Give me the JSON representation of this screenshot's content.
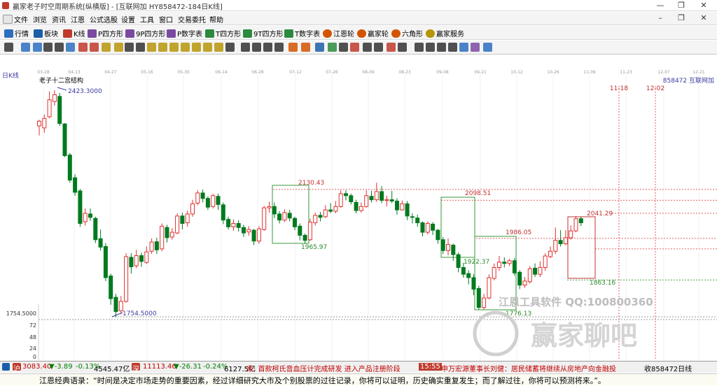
{
  "titlebar": {
    "title": "赢家老子时空周期系统[纵横版] - [互联网加  HY858472-184日K线]"
  },
  "menu": [
    "文件",
    "浏览",
    "资讯",
    "江恩",
    "公式选股",
    "设置",
    "工具",
    "窗口",
    "交易委托",
    "帮助"
  ],
  "nav": [
    {
      "label": "行情",
      "icon": "quote-icon",
      "color": "#2c6fbf"
    },
    {
      "label": "板块",
      "icon": "sector-icon",
      "color": "#1b5ea8"
    },
    {
      "label": "K线",
      "icon": "kline-icon",
      "color": "#c0392b"
    },
    {
      "label": "P四方形",
      "icon": "p-square-icon",
      "color": "#7a4aa0"
    },
    {
      "label": "9P四方形",
      "icon": "9p-square-icon",
      "color": "#7a4aa0"
    },
    {
      "label": "P数字表",
      "icon": "p-table-icon",
      "color": "#7a4aa0"
    },
    {
      "label": "T四方形",
      "icon": "t-square-icon",
      "color": "#2b8a3e"
    },
    {
      "label": "9T四方形",
      "icon": "9t-square-icon",
      "color": "#2b8a3e"
    },
    {
      "label": "T数字表",
      "icon": "t-table-icon",
      "color": "#2b8a3e"
    },
    {
      "label": "江恩轮",
      "icon": "gann-wheel-icon",
      "color": "#d35400"
    },
    {
      "label": "赢家轮",
      "icon": "winner-wheel-icon",
      "color": "#d35400"
    },
    {
      "label": "六角形",
      "icon": "hexagon-icon",
      "color": "#d35400"
    },
    {
      "label": "赢家服务",
      "icon": "service-icon",
      "color": "#b7950b"
    }
  ],
  "toolbar_colors": [
    "#333333",
    "#2c6fbf",
    "#2c6fbf",
    "#333333",
    "#333333",
    "#2c6fbf",
    "#c0392b",
    "#c0392b",
    "#b7950b",
    "#b7950b",
    "#333333",
    "#333333",
    "#b7950b",
    "#b7950b",
    "#b7950b",
    "#b7950b",
    "#b7950b",
    "#b7950b",
    "#b7950b",
    "#333333",
    "#333333",
    "#333333",
    "#333333",
    "#333333",
    "#d35400",
    "#d35400",
    "#1b5ea8",
    "#2b8a3e",
    "#333333",
    "#c0392b",
    "#333333",
    "#333333",
    "#c0392b",
    "#333333",
    "#333333",
    "#333333",
    "#333333",
    "#333333",
    "#2c6fbf",
    "#7a4aa0",
    "#2c6fbf"
  ],
  "chart_data": {
    "type": "candlestick",
    "period_label": "日K线",
    "indicator_label": "老子十二宫结构",
    "code_label": "858472  互联网加",
    "x_dates": [
      "03-28",
      "04-13",
      "04-27",
      "05-16",
      "05-30",
      "06-14",
      "06-28",
      "07-12",
      "07-26",
      "08-09",
      "08-23",
      "09-08",
      "09-21",
      "10-12",
      "10-26",
      "11-09",
      "11-23",
      "12-07",
      "12-21"
    ],
    "y_axis_labels": [
      "1754.5000",
      "72",
      "48",
      "24",
      "0"
    ],
    "up_color": "#e03030",
    "down_color": "#007a1f",
    "candles": [
      [
        2318,
        2332,
        2290,
        2336
      ],
      [
        2312,
        2340,
        2298,
        2352
      ],
      [
        2345,
        2395,
        2340,
        2420
      ],
      [
        2390,
        2410,
        2378,
        2423
      ],
      [
        2405,
        2325,
        2318,
        2415
      ],
      [
        2324,
        2230,
        2226,
        2326
      ],
      [
        2232,
        2158,
        2150,
        2238
      ],
      [
        2165,
        2122,
        2112,
        2175
      ],
      [
        2126,
        2030,
        2020,
        2132
      ],
      [
        2035,
        2060,
        2024,
        2074
      ],
      [
        2058,
        2048,
        2038,
        2074
      ],
      [
        2045,
        1982,
        1972,
        2050
      ],
      [
        1985,
        1960,
        1950,
        2012
      ],
      [
        1962,
        1870,
        1860,
        1972
      ],
      [
        1875,
        1808,
        1790,
        1882
      ],
      [
        1812,
        1770,
        1754,
        1822
      ],
      [
        1772,
        1800,
        1762,
        1816
      ],
      [
        1800,
        1932,
        1796,
        1942
      ],
      [
        1930,
        1902,
        1882,
        1942
      ],
      [
        1905,
        1935,
        1898,
        1952
      ],
      [
        1935,
        1918,
        1902,
        1944
      ],
      [
        1915,
        1946,
        1910,
        1962
      ],
      [
        1948,
        1975,
        1940,
        1986
      ],
      [
        1976,
        1952,
        1940,
        1988
      ],
      [
        1955,
        2022,
        1948,
        2030
      ],
      [
        2018,
        1988,
        1974,
        2026
      ],
      [
        1990,
        2004,
        1982,
        2016
      ],
      [
        2002,
        2052,
        1998,
        2060
      ],
      [
        2052,
        2030,
        2012,
        2062
      ],
      [
        2032,
        2058,
        2020,
        2068
      ],
      [
        2058,
        2088,
        2050,
        2100
      ],
      [
        2090,
        2120,
        2084,
        2128
      ],
      [
        2120,
        2104,
        2092,
        2130
      ],
      [
        2104,
        2078,
        2070,
        2110
      ],
      [
        2080,
        2112,
        2074,
        2118
      ],
      [
        2110,
        2086,
        2070,
        2118
      ],
      [
        2085,
        2040,
        2028,
        2092
      ],
      [
        2042,
        2020,
        2012,
        2050
      ],
      [
        2020,
        2030,
        2008,
        2042
      ],
      [
        2030,
        2018,
        2006,
        2040
      ],
      [
        2018,
        2002,
        1990,
        2026
      ],
      [
        2005,
        2012,
        1994,
        2022
      ],
      [
        2010,
        1978,
        1966,
        2014
      ],
      [
        1978,
        2014,
        1970,
        2022
      ],
      [
        2012,
        2076,
        2008,
        2082
      ],
      [
        2076,
        2080,
        2062,
        2094
      ],
      [
        2080,
        2058,
        2046,
        2092
      ],
      [
        2058,
        2040,
        2030,
        2066
      ],
      [
        2040,
        2062,
        2034,
        2072
      ],
      [
        2060,
        2046,
        2036,
        2070
      ],
      [
        2045,
        2020,
        2010,
        2050
      ],
      [
        2022,
        1995,
        1980,
        2030
      ],
      [
        1995,
        1980,
        1970,
        2000
      ],
      [
        1982,
        2034,
        1978,
        2044
      ],
      [
        2032,
        2054,
        2024,
        2062
      ],
      [
        2054,
        2048,
        2036,
        2064
      ],
      [
        2050,
        2070,
        2046,
        2084
      ],
      [
        2070,
        2066,
        2060,
        2090
      ],
      [
        2066,
        2080,
        2060,
        2096
      ],
      [
        2080,
        2118,
        2076,
        2128
      ],
      [
        2118,
        2112,
        2098,
        2128
      ],
      [
        2112,
        2094,
        2086,
        2118
      ],
      [
        2092,
        2068,
        2060,
        2100
      ],
      [
        2068,
        2080,
        2062,
        2092
      ],
      [
        2080,
        2112,
        2076,
        2128
      ],
      [
        2110,
        2100,
        2092,
        2126
      ],
      [
        2100,
        2124,
        2094,
        2150
      ],
      [
        2124,
        2098,
        2090,
        2140
      ],
      [
        2098,
        2100,
        2080,
        2112
      ],
      [
        2100,
        2096,
        2090,
        2126
      ],
      [
        2096,
        2070,
        2056,
        2104
      ],
      [
        2070,
        2088,
        2068,
        2098
      ],
      [
        2088,
        2052,
        2040,
        2096
      ],
      [
        2050,
        2048,
        2030,
        2060
      ],
      [
        2046,
        2032,
        2020,
        2056
      ],
      [
        2032,
        2004,
        1992,
        2036
      ],
      [
        2004,
        2030,
        1998,
        2036
      ],
      [
        2028,
        2010,
        1996,
        2034
      ],
      [
        2010,
        1982,
        1970,
        2014
      ],
      [
        1982,
        1950,
        1940,
        1990
      ],
      [
        1950,
        1968,
        1936,
        1986
      ],
      [
        1966,
        1938,
        1920,
        1970
      ],
      [
        1938,
        1900,
        1886,
        1944
      ],
      [
        1900,
        1880,
        1870,
        1914
      ],
      [
        1882,
        1870,
        1850,
        1892
      ],
      [
        1870,
        1836,
        1818,
        1880
      ],
      [
        1838,
        1782,
        1776,
        1846
      ],
      [
        1782,
        1810,
        1776,
        1822
      ],
      [
        1810,
        1870,
        1806,
        1880
      ],
      [
        1868,
        1900,
        1862,
        1912
      ],
      [
        1900,
        1916,
        1890,
        1934
      ],
      [
        1916,
        1912,
        1900,
        1930
      ],
      [
        1912,
        1920,
        1904,
        1926
      ],
      [
        1920,
        1884,
        1876,
        1928
      ],
      [
        1886,
        1848,
        1836,
        1892
      ],
      [
        1848,
        1860,
        1840,
        1872
      ],
      [
        1858,
        1896,
        1852,
        1904
      ],
      [
        1898,
        1880,
        1872,
        1912
      ],
      [
        1880,
        1900,
        1872,
        1918
      ],
      [
        1900,
        1934,
        1890,
        1942
      ],
      [
        1932,
        1948,
        1928,
        1962
      ],
      [
        1948,
        1980,
        1940,
        2018
      ],
      [
        1980,
        1970,
        1962,
        2010
      ],
      [
        1970,
        1988,
        1966,
        2010
      ],
      [
        1988,
        2008,
        1982,
        2024
      ],
      [
        2008,
        2044,
        2004,
        2052
      ],
      [
        2044,
        2032,
        2022,
        2050
      ]
    ],
    "annotations": [
      {
        "label": "2423.3000",
        "price": 2423.3,
        "color": "#3a3aa0"
      },
      {
        "label": "1754.5000",
        "price": 1754.5,
        "color": "#3a3aa0"
      },
      {
        "label": "2130.43",
        "price": 2130.43,
        "color": "#c03030"
      },
      {
        "label": "1965.97",
        "price": 1965.97,
        "color": "#2a8a2a"
      },
      {
        "label": "2098.51",
        "price": 2098.51,
        "color": "#c03030"
      },
      {
        "label": "1922.37",
        "price": 1922.37,
        "color": "#2a8a2a"
      },
      {
        "label": "1986.05",
        "price": 1986.05,
        "color": "#c03030"
      },
      {
        "label": "1776.13",
        "price": 1776.13,
        "color": "#2a8a2a"
      },
      {
        "label": "2041.29",
        "price": 2041.29,
        "color": "#c03030"
      },
      {
        "label": "1863.16",
        "price": 1863.16,
        "color": "#2a8a2a"
      }
    ],
    "date_markers": [
      "11-18",
      "12-02"
    ],
    "watermark_line1": "江恩工具软件  QQ:100800360",
    "watermark_line2": "赢家聊吧"
  },
  "status": {
    "sh_index": "3083.40",
    "sh_change": "▼-3.89",
    "sh_pct": "-0.13%",
    "sh_vol": "4545.47亿",
    "sz_index": "11113.46",
    "sz_change": "▼-26.31",
    "sz_pct": "-0.24%",
    "sz_vol": "6127.5亿",
    "news1": "耒;  首款柯氏音血压计完成研发 进入产品注册阶段",
    "news_time": "15:55",
    "news2": "申万宏源董事长刘健：居民储蓄将继续从房地产向金融投",
    "right": "收858472日线"
  },
  "quote": "江恩经典语录：“时间是决定市场走势的重要因素，经过详细研究大市及个别股票的过往记录，你将可以证明，历史确实重复发生；而了解过往，你将可以预测将来。”。"
}
